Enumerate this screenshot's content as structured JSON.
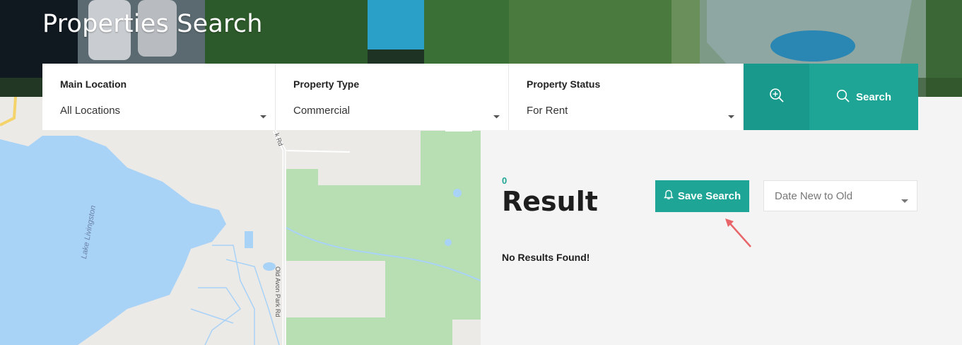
{
  "header": {
    "title": "Properties Search"
  },
  "search_form": {
    "fields": [
      {
        "label": "Main Location",
        "value": "All Locations"
      },
      {
        "label": "Property Type",
        "value": "Commercial"
      },
      {
        "label": "Property Status",
        "value": "For Rent"
      }
    ],
    "advanced_icon": "zoom-plus-icon",
    "search_icon": "search-icon",
    "search_label": "Search"
  },
  "map": {
    "lake_label": "Lake Livingston",
    "road_label_1": "Old Avon Park Rd",
    "road_label_2": "k Rd"
  },
  "results": {
    "count": "0",
    "heading": "Result",
    "save_search_icon": "bell-icon",
    "save_search_label": "Save Search",
    "sort_value": "Date New to Old",
    "empty_message": "No Results Found!"
  },
  "colors": {
    "accent": "#1fa595",
    "accent_dark": "#18998b",
    "annotation_arrow": "#e8666a"
  }
}
